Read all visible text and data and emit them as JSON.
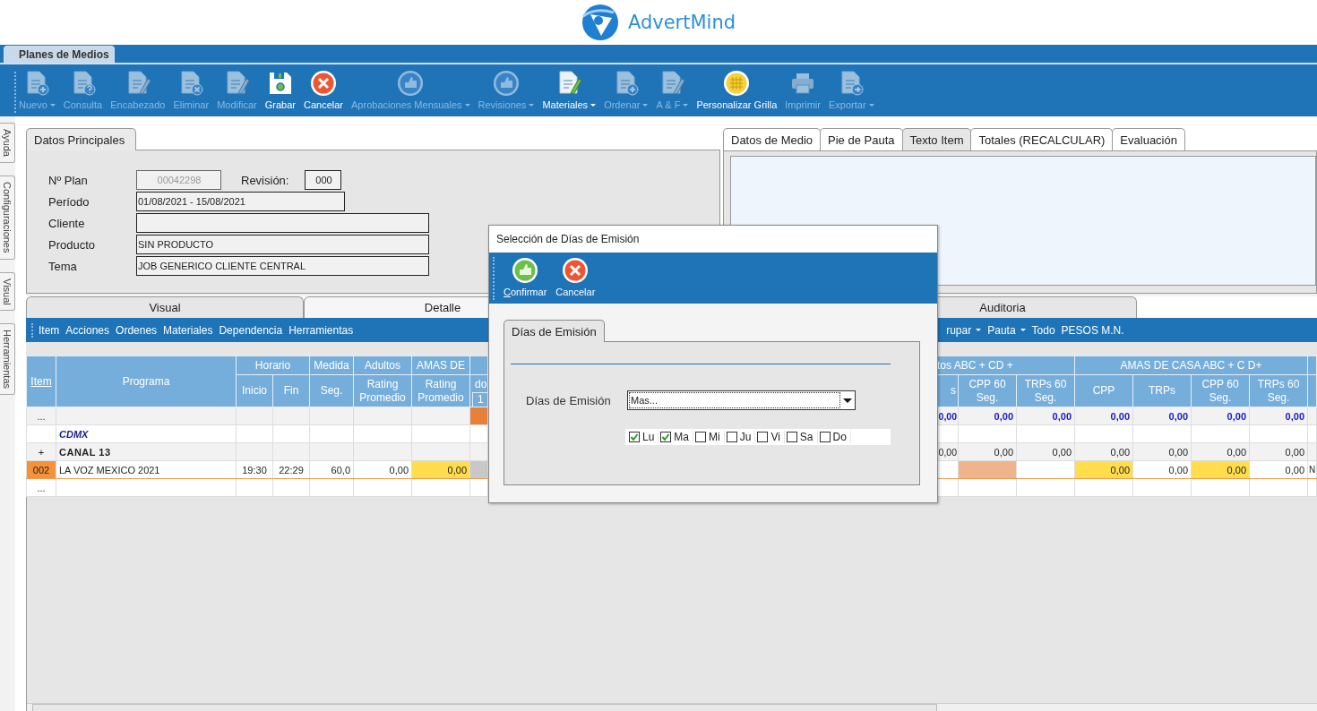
{
  "app_header": {
    "logo_text": "AdvertMind"
  },
  "document_tabs": [
    {
      "label": "Planes de Medios",
      "selected": true
    }
  ],
  "toolbar": [
    {
      "label": "Nuevo",
      "disabled": true,
      "dropdown": true
    },
    {
      "label": "Consulta",
      "disabled": true,
      "dropdown": false
    },
    {
      "label": "Encabezado",
      "disabled": true,
      "dropdown": false
    },
    {
      "label": "Eliminar",
      "disabled": true,
      "dropdown": false
    },
    {
      "label": "Modificar",
      "disabled": true,
      "dropdown": false
    },
    {
      "label": "Grabar",
      "disabled": false,
      "dropdown": false
    },
    {
      "label": "Cancelar",
      "disabled": false,
      "dropdown": false
    },
    {
      "label": "Aprobaciones Mensuales",
      "disabled": true,
      "dropdown": true
    },
    {
      "label": "Revisiones",
      "disabled": true,
      "dropdown": true
    },
    {
      "label": "Materiales",
      "disabled": false,
      "dropdown": true
    },
    {
      "label": "Ordenar",
      "disabled": true,
      "dropdown": true
    },
    {
      "label": "A & F",
      "disabled": true,
      "dropdown": true
    },
    {
      "label": "Personalizar Grilla",
      "disabled": false,
      "dropdown": false
    },
    {
      "label": "Imprimir",
      "disabled": true,
      "dropdown": false
    },
    {
      "label": "Exportar",
      "disabled": true,
      "dropdown": true
    }
  ],
  "side_tabs": [
    "Ayuda",
    "Configuraciones",
    "Visual",
    "Herramientas"
  ],
  "main_panel": {
    "tab": "Datos Principales",
    "rows": [
      {
        "fields": [
          {
            "label": "Nº Plan",
            "value": "00042298",
            "kind": "code",
            "disabled": true
          },
          {
            "label": "Revisión:",
            "value": "000",
            "kind": "small",
            "disabled": false
          }
        ]
      },
      {
        "fields": [
          {
            "label": "Período",
            "value": "01/08/2021 - 15/08/2021",
            "kind": "medium",
            "disabled": false
          }
        ]
      },
      {
        "fields": [
          {
            "label": "Cliente",
            "kind": "long",
            "disabled": false
          }
        ]
      },
      {
        "fields": [
          {
            "label": "Producto",
            "value": "SIN PRODUCTO",
            "kind": "long",
            "disabled": false
          }
        ]
      },
      {
        "fields": [
          {
            "label": "Tema",
            "value": "JOB GENERICO CLIENTE CENTRAL",
            "kind": "long",
            "disabled": false
          }
        ]
      }
    ]
  },
  "side_panel": {
    "tabs": [
      {
        "label": "Datos de Medio",
        "selected": false
      },
      {
        "label": "Pie de Pauta",
        "selected": false
      },
      {
        "label": "Texto Item",
        "selected": true
      },
      {
        "label": "Totales (RECALCULAR)",
        "selected": false
      },
      {
        "label": "Evaluación",
        "selected": false
      }
    ]
  },
  "view_tabs": [
    {
      "label": "Visual",
      "selected": false
    },
    {
      "label": "Detalle",
      "selected": true
    },
    {
      "label": "Auditoria",
      "selected": false
    }
  ],
  "grid_toolbar": {
    "left": [
      "Item",
      "Acciones",
      "Ordenes",
      "Materiales",
      "Dependencia",
      "Herramientas"
    ],
    "right": [
      {
        "label": "rupar",
        "dropdown": true
      },
      {
        "label": "Pauta",
        "dropdown": true
      },
      {
        "label": "Todo",
        "dropdown": false
      },
      {
        "label": "PESOS M.N.",
        "dropdown": false
      }
    ]
  },
  "grid": {
    "left_header": [
      {
        "label": "Item",
        "kind": "link"
      },
      {
        "label": "Programa",
        "kind": "tall"
      },
      {
        "label": "Horario",
        "kind": "group",
        "columns": [
          {
            "label": "Inicio"
          },
          {
            "label": "Fin"
          }
        ]
      },
      {
        "label": "Medida",
        "kind": "group",
        "columns": [
          {
            "label": "Seg."
          }
        ]
      },
      {
        "label": "Adultos",
        "kind": "group",
        "columns": [
          {
            "label": "Rating Promedio"
          }
        ]
      },
      {
        "label": "AMAS DE",
        "kind": "group",
        "columns": [
          {
            "label": "Rating Promedio"
          }
        ]
      },
      {
        "kind": "group",
        "columns": [
          {
            "label": "do",
            "sub": "1"
          }
        ]
      }
    ],
    "right_header": [
      {
        "label": "tos ABC + CD +",
        "kind": "group",
        "columns": [
          {
            "label": "s"
          },
          {
            "label": "CPP 60 Seg."
          },
          {
            "label": "TRPs 60 Seg."
          }
        ]
      },
      {
        "label": "AMAS DE CASA ABC + C D+",
        "kind": "group",
        "columns": [
          {
            "label": "CPP"
          },
          {
            "label": "TRPs"
          },
          {
            "label": "CPP 60 Seg."
          },
          {
            "label": "TRPs 60 Seg."
          }
        ]
      },
      {
        "kind": "blank"
      }
    ],
    "rows": [
      {
        "kind": "summary",
        "cells": [
          "...",
          "",
          "",
          "",
          "",
          "",
          "",
          {
            "color": "#e8803a"
          },
          "0,00",
          "0,00",
          "0,00",
          "0,00",
          "0,00",
          "0,00",
          "0,00",
          ""
        ]
      },
      {
        "kind": "group",
        "cells": [
          "",
          "CDMX",
          "",
          "",
          "",
          "",
          "",
          "",
          "",
          "",
          "",
          "",
          "",
          "",
          "",
          ""
        ]
      },
      {
        "kind": "channel",
        "cells": [
          "+",
          "CANAL 13",
          "",
          "",
          "",
          "",
          "",
          "",
          "0,00",
          "0,00",
          "0,00",
          "0,00",
          "0,00",
          "0,00",
          "0,00",
          ""
        ]
      },
      {
        "kind": "item",
        "cells": [
          {
            "text": "002",
            "color": "#f5923a"
          },
          "LA VOZ MEXICO 2021",
          "19:30",
          "22:29",
          "60,0",
          "0,00",
          {
            "text": "0,00",
            "color": "#ffdd4d"
          },
          {
            "color": "#c8c8c8"
          },
          "",
          {
            "color": "#f0b48c"
          },
          "",
          {
            "text": "0,00",
            "color": "#ffdd4d"
          },
          "0,00",
          {
            "text": "0,00",
            "color": "#ffdd4d"
          },
          "0,00",
          "N"
        ]
      },
      {
        "kind": "blank",
        "cells": [
          "...",
          "",
          "",
          "",
          "",
          "",
          "",
          "",
          "",
          "",
          "",
          "",
          "",
          "",
          "",
          ""
        ]
      }
    ]
  },
  "dialog": {
    "title": "Selección de Días de Emisión",
    "actions": [
      {
        "label": "Confirmar"
      },
      {
        "label": "Cancelar"
      }
    ],
    "tab": "Días de Emisión",
    "select": {
      "label": "Días de Emisión",
      "value": "Mas..."
    },
    "days": [
      {
        "label": "Lu",
        "checked": true
      },
      {
        "label": "Ma",
        "checked": true
      },
      {
        "label": "Mi",
        "checked": false
      },
      {
        "label": "Ju",
        "checked": false
      },
      {
        "label": "Vi",
        "checked": false
      },
      {
        "label": "Sa",
        "checked": false
      },
      {
        "label": "Do",
        "checked": false
      }
    ]
  }
}
